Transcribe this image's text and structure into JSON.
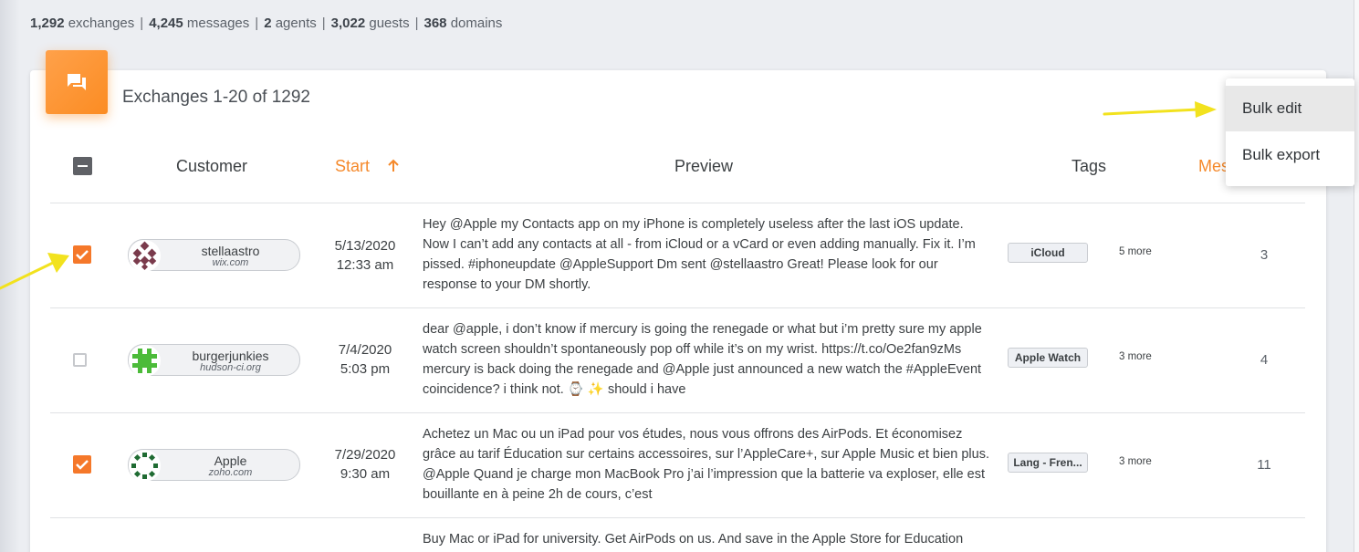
{
  "stats": {
    "exchanges_count": "1,292",
    "exchanges_label": "exchanges",
    "messages_count": "4,245",
    "messages_label": "messages",
    "agents_count": "2",
    "agents_label": "agents",
    "guests_count": "3,022",
    "guests_label": "guests",
    "domains_count": "368",
    "domains_label": "domains",
    "separator": "|"
  },
  "card": {
    "icon": "chat-bubbles-icon",
    "title": "Exchanges 1-20 of 1292"
  },
  "table": {
    "headers": {
      "customer": "Customer",
      "start": "Start",
      "preview": "Preview",
      "tags": "Tags",
      "messages": "Mes"
    },
    "sort_icon": "arrow-up-icon",
    "rows": [
      {
        "checked": true,
        "name": "stellaastro",
        "domain": "wix.com",
        "date": "5/13/2020",
        "time": "12:33 am",
        "preview": "Hey @Apple my Contacts app on my iPhone is completely useless after the last iOS update. Now I can’t add any contacts at all - from iCloud or a vCard or even adding manually. Fix it. I’m pissed. #iphoneupdate @AppleSupport Dm sent @stellaastro Great! Please look for our response to your DM shortly.",
        "tag": "iCloud",
        "more": "5 more",
        "count": "3"
      },
      {
        "checked": false,
        "name": "burgerjunkies",
        "domain": "hudson-ci.org",
        "date": "7/4/2020",
        "time": "5:03 pm",
        "preview": "dear @apple, i don’t know if mercury is going the renegade or what but i’m pretty sure my apple watch screen shouldn’t spontaneously pop off while it’s on my wrist. https://t.co/Oe2fan9zMs mercury is back doing the renegade and @Apple just announced a new watch the #AppleEvent  coincidence? i think not. ⌚ ✨  should i have",
        "tag": "Apple Watch",
        "more": "3 more",
        "count": "4"
      },
      {
        "checked": true,
        "name": "Apple",
        "domain": "zoho.com",
        "date": "7/29/2020",
        "time": "9:30 am",
        "preview": "Achetez un Mac ou un iPad pour vos études, nous vous offrons des AirPods. Et économisez grâce au tarif Éducation sur certains accessoires, sur l’AppleCare+, sur Apple Music et bien plus. @Apple Quand je charge mon MacBook Pro j’ai l’impression que la batterie va exploser, elle est bouillante en à peine 2h de cours, c’est",
        "tag": "Lang - Fren...",
        "more": "3 more",
        "count": "11"
      },
      {
        "preview": "Buy Mac or iPad for university. Get AirPods on us. And save in the Apple Store for Education"
      }
    ]
  },
  "menu": {
    "items": [
      "Bulk edit",
      "Bulk export"
    ]
  },
  "colors": {
    "accent": "#f5892b",
    "checkbox_checked": "#f5782a",
    "annotation_arrow": "#f2e21e"
  }
}
